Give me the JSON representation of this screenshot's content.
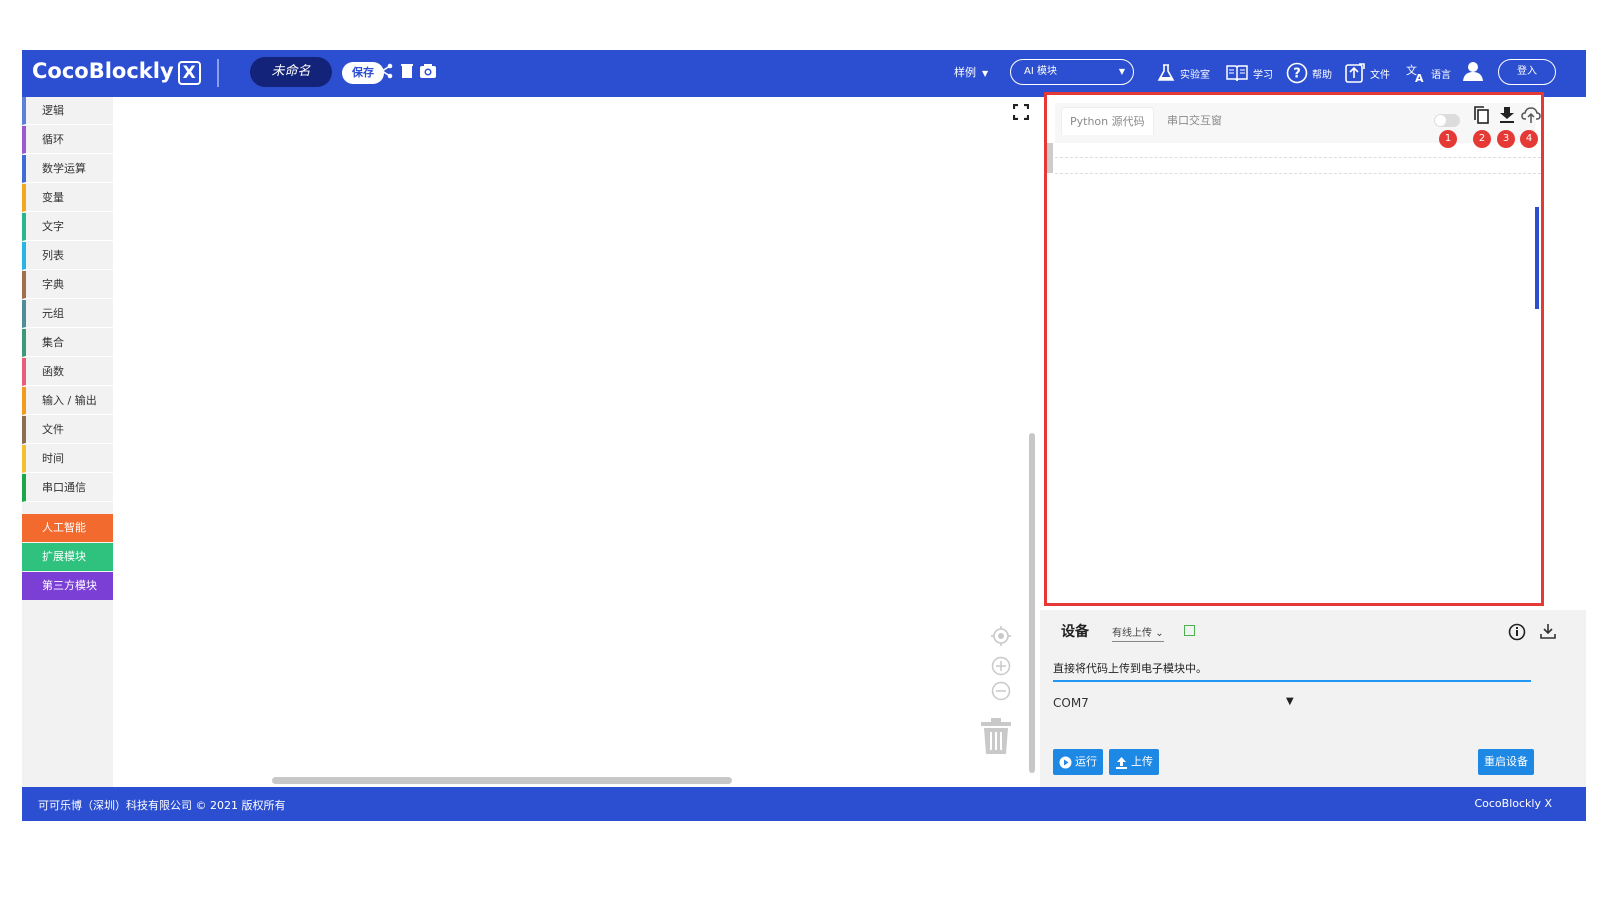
{
  "app": {
    "logo_text": "CocoBlockly",
    "logo_badge": "X",
    "project_name": "未命名",
    "save_label": "保存"
  },
  "topbar": {
    "sample_label": "样例",
    "ai_module_label": "AI 模块",
    "lab_label": "实验室",
    "learn_label": "学习",
    "help_label": "帮助",
    "file_label": "文件",
    "language_label": "语言",
    "login_label": "登入"
  },
  "sidebar": {
    "categories": [
      {
        "label": "逻辑",
        "color": "#5b80d9"
      },
      {
        "label": "循环",
        "color": "#9b59d0"
      },
      {
        "label": "数学运算",
        "color": "#3f6ad8"
      },
      {
        "label": "变量",
        "color": "#f5a623"
      },
      {
        "label": "文字",
        "color": "#28b78d"
      },
      {
        "label": "列表",
        "color": "#2bb3e6"
      },
      {
        "label": "字典",
        "color": "#a0704c"
      },
      {
        "label": "元组",
        "color": "#4f8e99"
      },
      {
        "label": "集合",
        "color": "#3c9a78"
      },
      {
        "label": "函数",
        "color": "#e95d7b"
      },
      {
        "label": "输入 / 输出",
        "color": "#f39a1f"
      },
      {
        "label": "文件",
        "color": "#8d6e4f"
      },
      {
        "label": "时间",
        "color": "#f5c030"
      },
      {
        "label": "串口通信",
        "color": "#1aa84b"
      }
    ],
    "special": [
      {
        "label": "人工智能",
        "color": "#f26a2d"
      },
      {
        "label": "扩展模块",
        "color": "#2ec27e"
      },
      {
        "label": "第三方模块",
        "color": "#7b3fd6"
      }
    ]
  },
  "code_panel": {
    "tab_python": "Python 源代码",
    "tab_serial": "串口交互窗",
    "badges": [
      "1",
      "2",
      "3",
      "4"
    ]
  },
  "device": {
    "title": "设备",
    "upload_mode": "有线上传",
    "description": "直接将代码上传到电子模块中。",
    "port": "COM7",
    "run_label": "运行",
    "upload_label": "上传",
    "restart_label": "重启设备"
  },
  "footer": {
    "copyright": "可可乐博（深圳）科技有限公司 © 2021 版权所有",
    "brand": "CocoBlockly X"
  },
  "colors": {
    "primary": "#2c4fd1",
    "highlight_border": "#e53935",
    "action_blue": "#1e88e5"
  }
}
